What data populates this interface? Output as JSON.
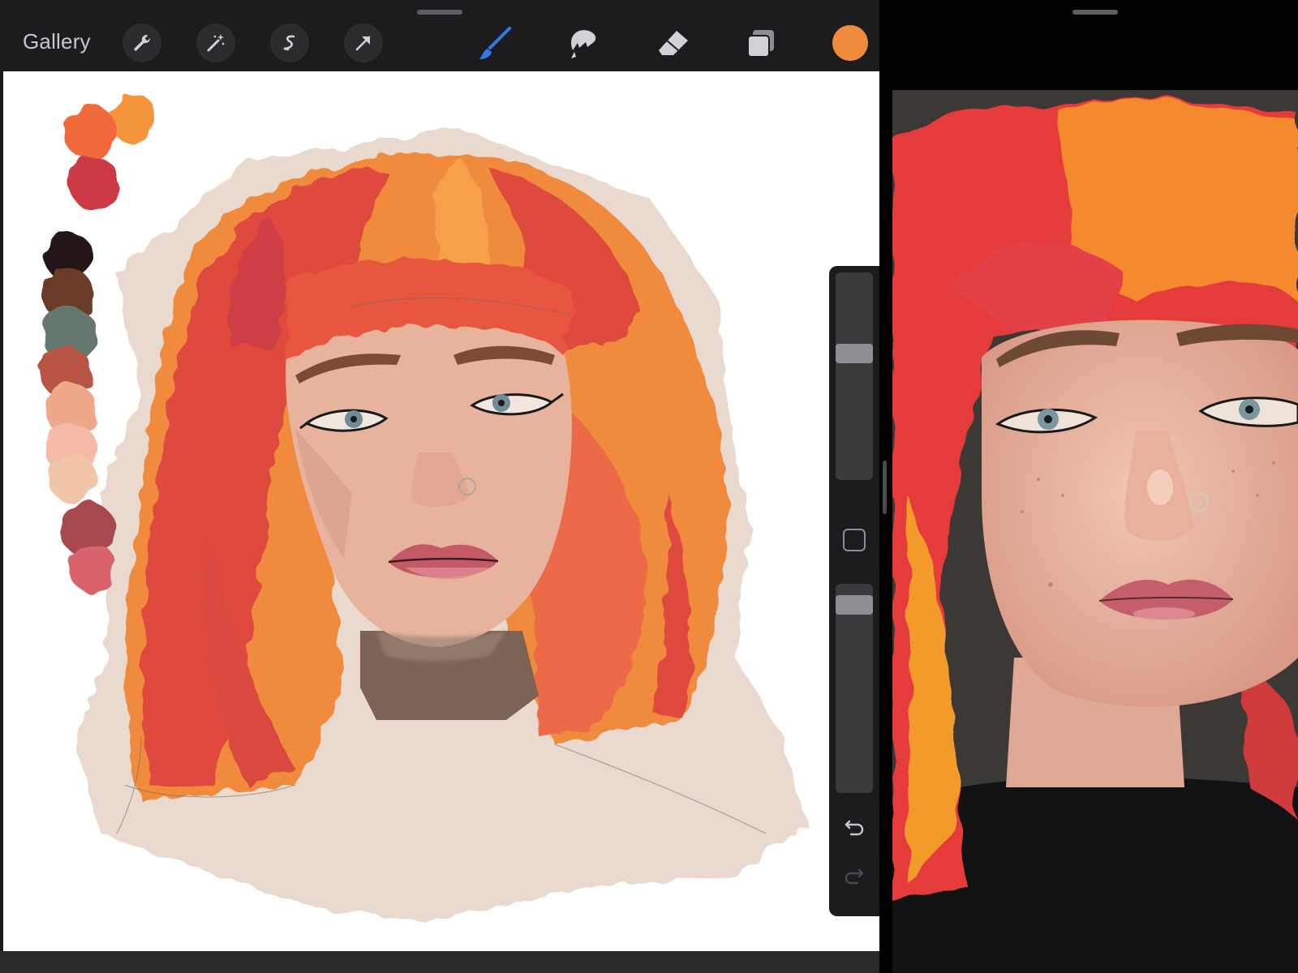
{
  "toolbar": {
    "gallery_label": "Gallery",
    "current_color": "#F08A3C",
    "active_tool_color": "#2F7BEA",
    "icons": [
      "wrench-icon",
      "magic-wand-icon",
      "selection-icon",
      "transform-arrow-icon",
      "brush-icon",
      "smudge-icon",
      "eraser-icon",
      "layers-icon"
    ]
  },
  "palette": {
    "swatches": [
      "#F26A3A",
      "#F5953A",
      "#CC3A45",
      "#231414",
      "#6B3A28",
      "#66776E",
      "#B85444",
      "#EFA889",
      "#F5BBA6",
      "#F1C6A8",
      "#A84A50",
      "#D9646C"
    ]
  },
  "sidebar": {
    "brush_size_level": 0.62,
    "opacity_level": 0.94
  },
  "colors": {
    "hair_red": "#E0483E",
    "hair_orange": "#F48A3A",
    "skin": "#E8B39C",
    "background_wash": "#E9D9CE",
    "eye": "#6D8C96",
    "lips": "#C55A67"
  }
}
